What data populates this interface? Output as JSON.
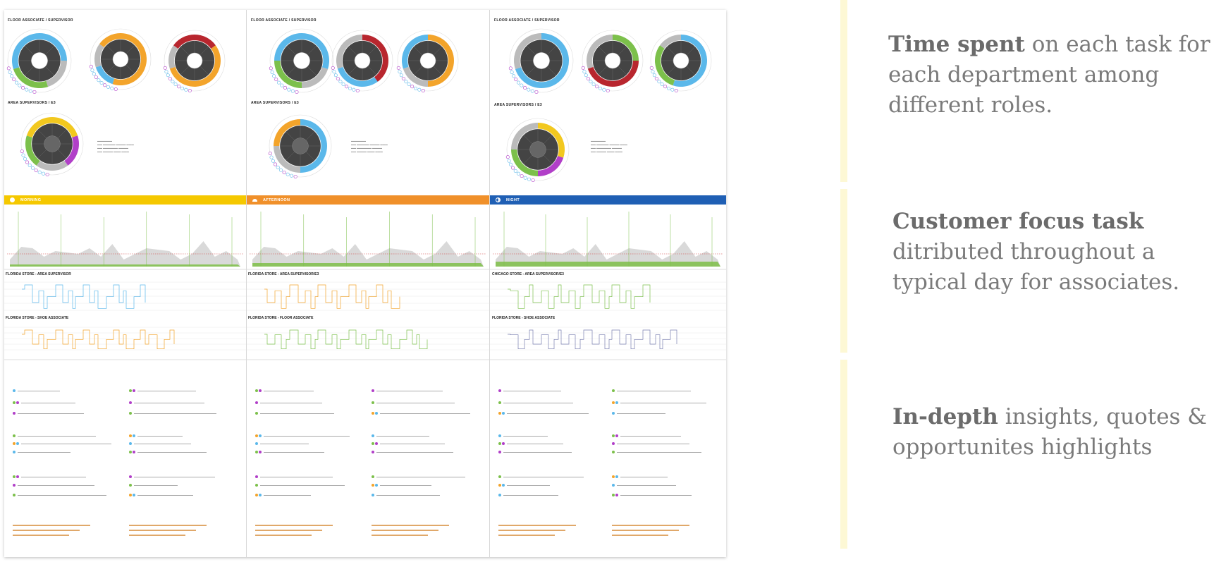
{
  "board": {
    "columns": [
      {
        "floor_role": "FLOOR ASSOCIATE / SUPERVISOR",
        "area_role": "AREA SUPERVISORS / E3",
        "shift": {
          "label": "MORNING",
          "color": "#f5c800"
        },
        "store_a": "FLORIDA STORE - AREA SUPERVISOR",
        "store_b": "FLORIDA STORE - SHOE ASSOCIATE"
      },
      {
        "floor_role": "FLOOR ASSOCIATE / SUPERVISOR",
        "area_role": "AREA SUPERVISORS / E3",
        "shift": {
          "label": "AFTERNOON",
          "color": "#f0902a"
        },
        "store_a": "FLORIDA STORE - AREA SUPERVISOR/E3",
        "store_b": "FLORIDA STORE - FLOOR ASSOCIATE"
      },
      {
        "floor_role": "FLOOR ASSOCIATE / SUPERVISOR",
        "area_role": "AREA SUPERVISORS / E3",
        "shift": {
          "label": "NIGHT",
          "color": "#1f5fb4"
        },
        "store_a": "CHICAGO STORE - AREA SUPERVISOR/E3",
        "store_b": "FLORIDA STORE - SHOE ASSOCIATE"
      }
    ]
  },
  "colors": {
    "donut_core": "#444444",
    "blue": "#5bb8ea",
    "orange": "#f3a42b",
    "green": "#7cc04b",
    "red": "#b8262e",
    "yellow": "#f2c81f",
    "purple": "#b13fc8",
    "gray": "#bbbbbb",
    "accent_bar": "#fdf8d5"
  },
  "highlights": [
    {
      "strong": "Time spent",
      "rest_1": " on each task for",
      "line2": "each department among",
      "line3": "different roles."
    },
    {
      "strong": "Customer focus task",
      "line2": "ditributed throughout a",
      "line3": "typical day for associates."
    },
    {
      "strong": "In-depth",
      "rest_1": " insights, quotes &",
      "line2": "opportunites highlights"
    }
  ]
}
